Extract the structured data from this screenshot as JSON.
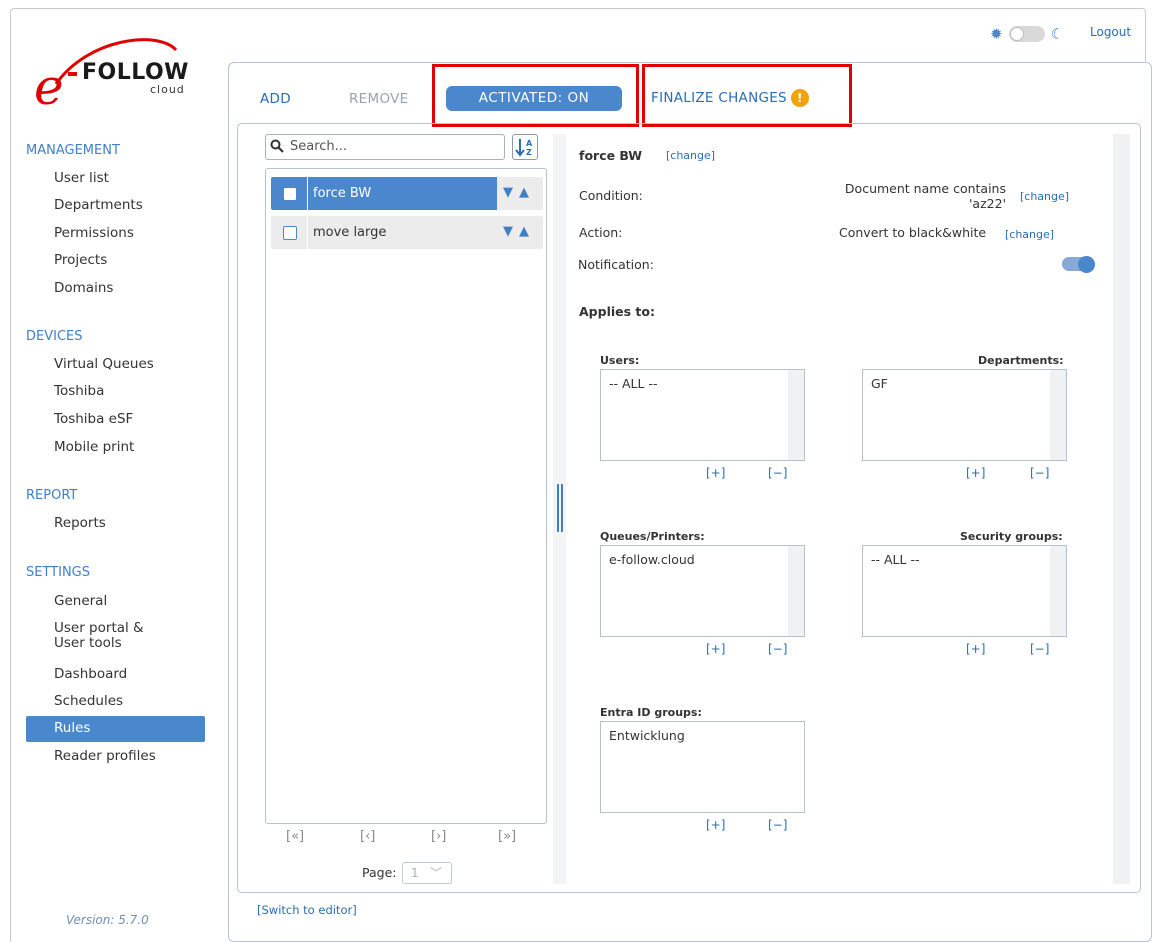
{
  "app": {
    "logo_text": "FOLLOW",
    "logo_prefix": "e",
    "logo_sub": "cloud",
    "logout": "Logout",
    "version": "Version: 5.7.0"
  },
  "sidebar": {
    "sections": [
      {
        "title": "MANAGEMENT",
        "items": [
          "User list",
          "Departments",
          "Permissions",
          "Projects",
          "Domains"
        ]
      },
      {
        "title": "DEVICES",
        "items": [
          "Virtual Queues",
          "Toshiba",
          "Toshiba eSF",
          "Mobile print"
        ]
      },
      {
        "title": "REPORT",
        "items": [
          "Reports"
        ]
      },
      {
        "title": "SETTINGS",
        "items": [
          "General",
          "User portal &",
          "User tools",
          "Dashboard",
          "Schedules",
          "Rules",
          "Reader profiles"
        ]
      }
    ],
    "active": "Rules"
  },
  "toolbar": {
    "add": "ADD",
    "remove": "REMOVE",
    "activated": "ACTIVATED: ON",
    "finalize": "FINALIZE CHANGES",
    "warn": "!"
  },
  "list": {
    "search_placeholder": "Search...",
    "rows": [
      {
        "label": "force BW",
        "selected": true
      },
      {
        "label": "move large",
        "selected": false
      }
    ],
    "pager": {
      "first": "[«]",
      "prev": "[‹]",
      "next": "[›]",
      "last": "[»]",
      "page_label": "Page:",
      "page_value": "1"
    }
  },
  "detail": {
    "rule_name": "force BW",
    "change": "[change]",
    "condition_label": "Condition:",
    "condition_value_1": "Document name contains",
    "condition_value_2": "'az22'",
    "action_label": "Action:",
    "action_value": "Convert to black&white",
    "notification_label": "Notification:",
    "notification_on": true,
    "applies_to": "Applies to:",
    "groups": {
      "users": {
        "title": "Users:",
        "value": "-- ALL --"
      },
      "departments": {
        "title": "Departments:",
        "value": "GF"
      },
      "queues": {
        "title": "Queues/Printers:",
        "value": "e-follow.cloud"
      },
      "security": {
        "title": "Security groups:",
        "value": "-- ALL --"
      },
      "entra": {
        "title": "Entra ID groups:",
        "value": "Entwicklung"
      }
    },
    "plus": "[+]",
    "minus": "[−]"
  },
  "footer": {
    "switch_editor": "[Switch to editor]"
  },
  "colors": {
    "accent": "#4a87cd",
    "link": "#2a6db5",
    "highlight": "#e00000",
    "warn": "#f0a30a"
  }
}
